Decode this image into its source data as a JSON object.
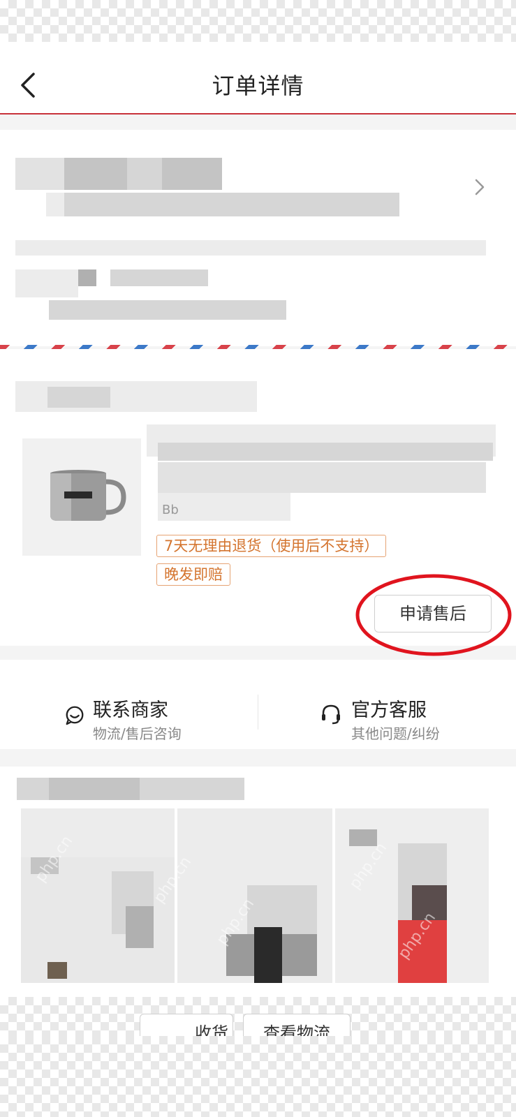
{
  "header": {
    "title": "订单详情",
    "back_icon": "chevron-left-icon"
  },
  "product": {
    "name_fragment": "Bb",
    "tags": [
      "7天无理由退货（使用后不支持）",
      "晚发即赔"
    ],
    "after_sale_button": "申请售后",
    "image_icon": "mug-image"
  },
  "service": {
    "contact_merchant": {
      "title": "联系商家",
      "subtitle": "物流/售后咨询",
      "icon": "chat-smile-icon"
    },
    "customer_service": {
      "title": "官方客服",
      "subtitle": "其他问题/纠纷",
      "icon": "headset-icon"
    }
  },
  "bottom_bar": {
    "confirm_receipt": "收货",
    "view_logistics": "查看物流"
  },
  "watermark": "php.cn",
  "colors": {
    "accent_red": "#c8323a",
    "tag_orange": "#d4742e",
    "annotation_circle": "#e0141e"
  }
}
